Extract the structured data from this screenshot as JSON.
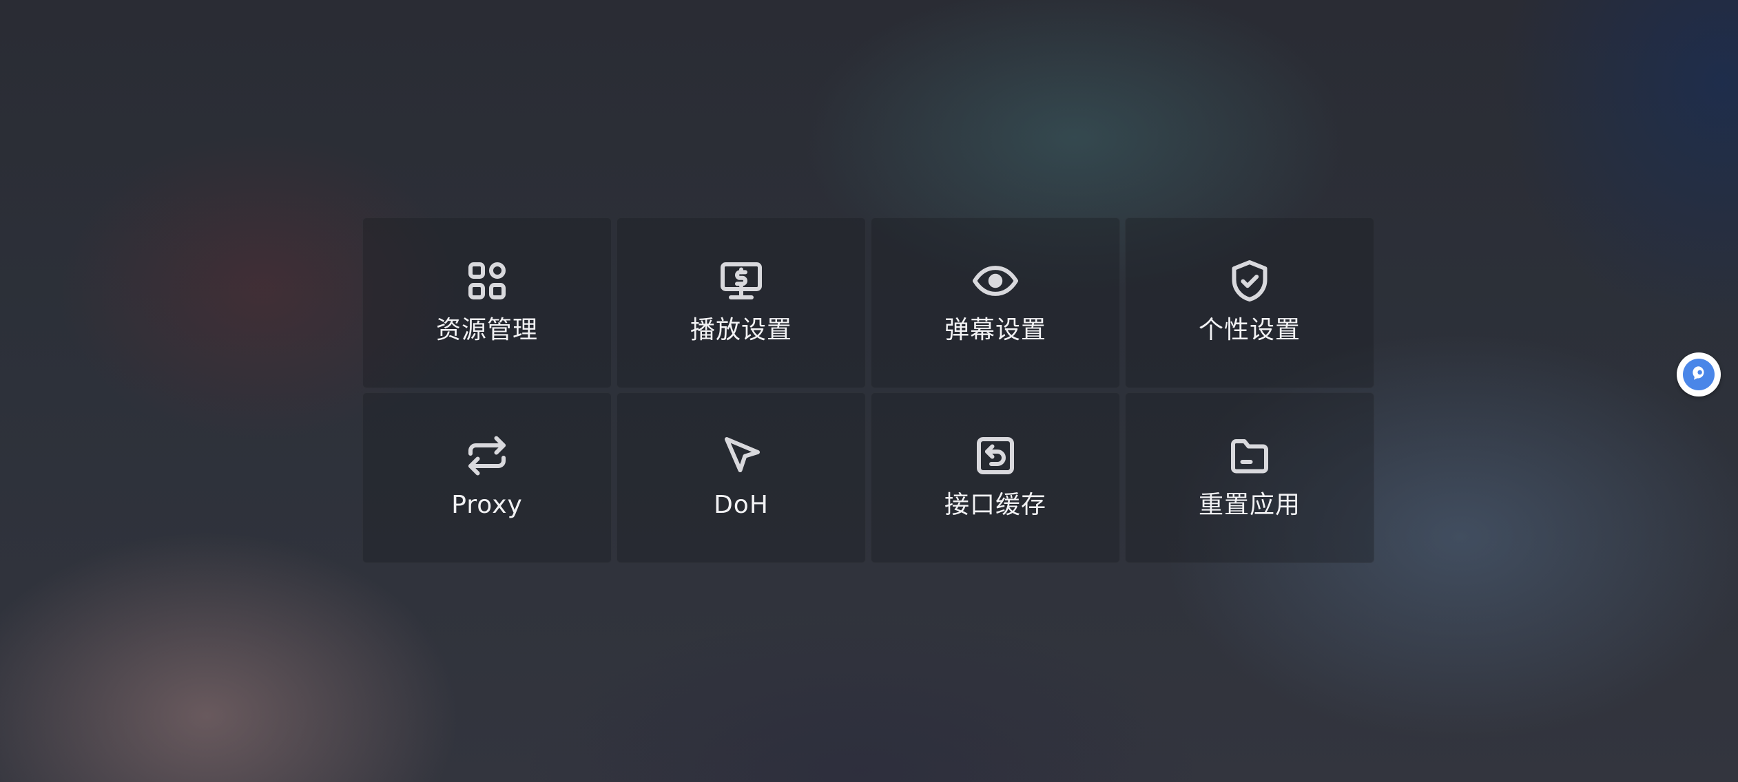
{
  "menu": {
    "tiles": [
      {
        "label": "资源管理",
        "icon": "apps-grid-icon"
      },
      {
        "label": "播放设置",
        "icon": "monitor-dollar-icon"
      },
      {
        "label": "弹幕设置",
        "icon": "eye-icon"
      },
      {
        "label": "个性设置",
        "icon": "shield-check-icon"
      },
      {
        "label": "Proxy",
        "icon": "arrows-exchange-icon"
      },
      {
        "label": "DoH",
        "icon": "cursor-pointer-icon"
      },
      {
        "label": "接口缓存",
        "icon": "square-undo-icon"
      },
      {
        "label": "重置应用",
        "icon": "folder-icon"
      }
    ]
  },
  "floating_button": {
    "icon": "assistant-bubble-icon",
    "color": "#4a86e8"
  }
}
